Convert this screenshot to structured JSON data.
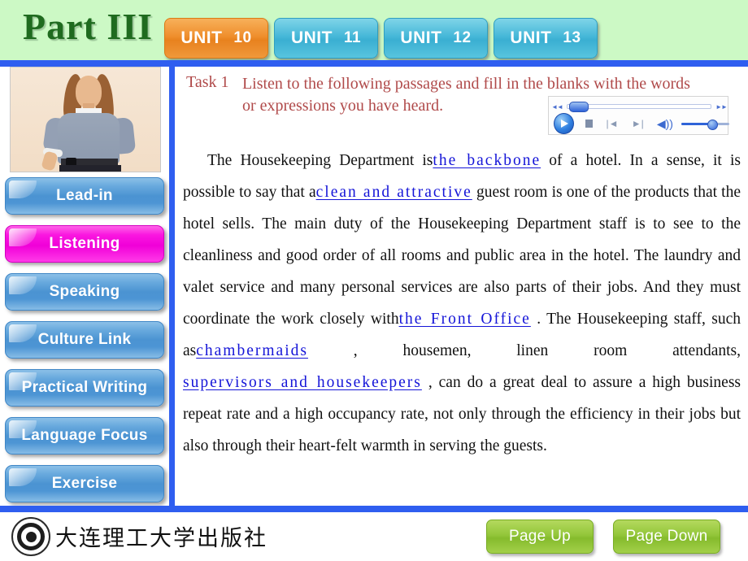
{
  "header": {
    "part_title": "Part III",
    "units": [
      {
        "word": "UNIT",
        "number": "10",
        "active": true
      },
      {
        "word": "UNIT",
        "number": "11",
        "active": false
      },
      {
        "word": "UNIT",
        "number": "12",
        "active": false
      },
      {
        "word": "UNIT",
        "number": "13",
        "active": false
      }
    ],
    "accent_active": "#e8821e",
    "accent_inactive": "#3aafd2",
    "background": "#ccf9c5",
    "rule_color": "#2f5ef0"
  },
  "sidebar": {
    "photo_alt": "hotel housekeeping staff photo",
    "items": [
      {
        "label": "Lead-in",
        "active": false
      },
      {
        "label": "Listening",
        "active": true
      },
      {
        "label": "Speaking",
        "active": false
      },
      {
        "label": "Culture Link",
        "active": false
      },
      {
        "label": "Practical Writing",
        "active": false
      },
      {
        "label": "Language Focus",
        "active": false
      },
      {
        "label": "Exercise",
        "active": false
      }
    ],
    "active_color": "#f000d8",
    "inactive_color": "#4b93d2"
  },
  "content": {
    "task_label": "Task 1",
    "task_instruction": "Listen to the following passages and fill in the blanks with the words or expressions you have heard.",
    "task_color": "#b04a4a",
    "passage": {
      "p1_a": "The Housekeeping Department is",
      "blank1": "the backbone",
      "p1_b": "of a hotel. In a sense, it is possible to say that a",
      "blank2": "clean and attractive",
      "p1_c": "guest room is one of the products that the hotel sells. The main duty of the Housekeeping Department staff is to see to the cleanliness and good order of all rooms and public area in the hotel. The laundry and valet service and many personal services are also parts of their jobs. And they must coordinate the work closely with",
      "blank3": "the Front Office",
      "p1_d": ". The Housekeeping staff, such as",
      "blank4": "chambermaids",
      "p1_e": ", housemen, linen room attendants,",
      "blank5": "supervisors and housekeepers",
      "p1_f": ", can do a great deal to assure a high business repeat rate and a high occupancy rate, not only through the efficiency in their jobs but also through their heart-felt warmth in serving the guests.",
      "blank_color": "#1414d8"
    }
  },
  "player": {
    "rewind_icon": "◄◄",
    "forward_icon": "►►",
    "play_icon": "play-triangle",
    "stop_icon": "stop-square",
    "previous_icon": "|◄",
    "next_icon": "►|",
    "volume_icon": "◀))",
    "seek_position_percent": 3,
    "volume_percent": 58
  },
  "footer": {
    "publisher": "大连理工大学出版社",
    "logo_name": "dalian-university-of-technology-press-logo",
    "page_up": "Page Up",
    "page_down": "Page Down",
    "button_color": "#85bb2c"
  }
}
